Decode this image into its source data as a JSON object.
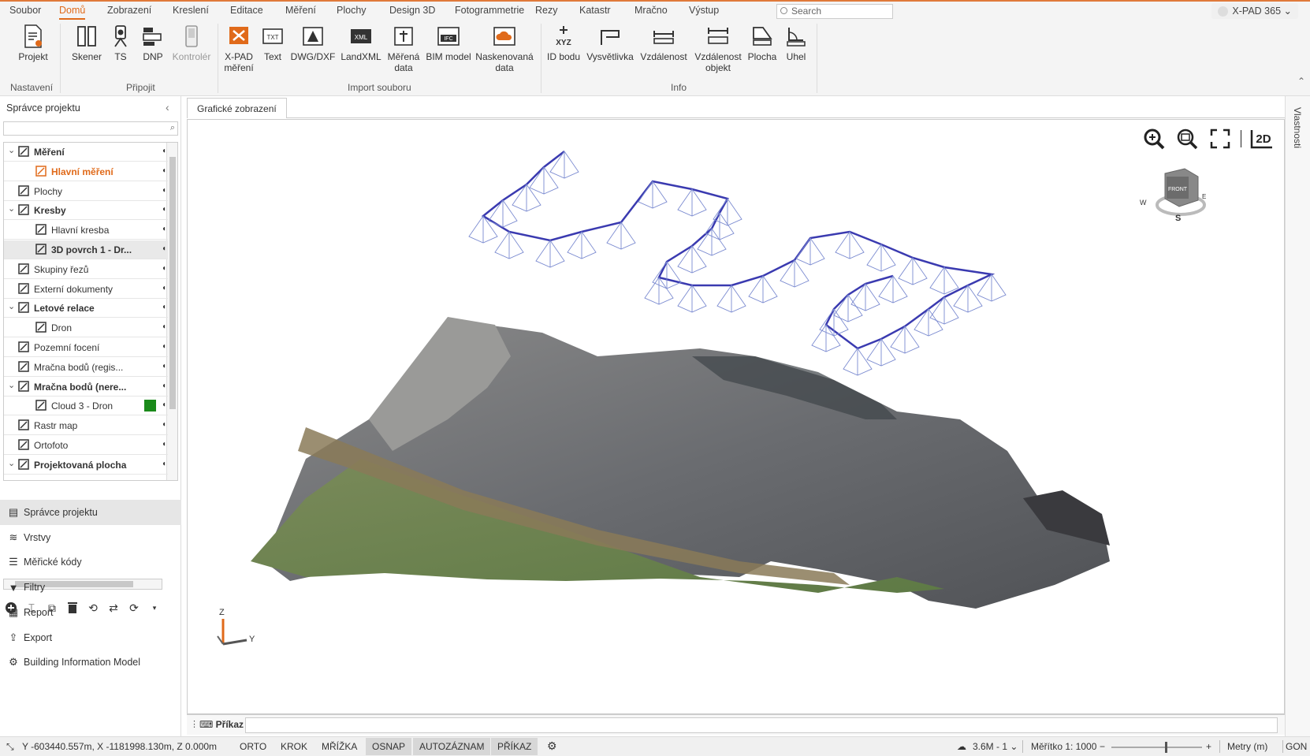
{
  "menu": {
    "items": [
      "Soubor",
      "Domů",
      "Zobrazení",
      "Kreslení",
      "Editace",
      "Měření",
      "Plochy",
      "Design 3D",
      "Fotogrammetrie",
      "Rezy",
      "Katastr",
      "Mračno",
      "Výstup"
    ],
    "search_placeholder": "Search",
    "product": "X-PAD 365"
  },
  "ribbon": {
    "buttons": {
      "projekt": "Projekt",
      "skener": "Skener",
      "ts": "TS",
      "dnp": "DNP",
      "kontroler": "Kontrolér",
      "xpad_mereni": "X-PAD měření",
      "text": "Text",
      "dwg": "DWG/DXF",
      "landxml": "LandXML",
      "merena_data": "Měřená data",
      "bim": "BIM model",
      "naskenovana": "Naskenovaná data",
      "id_bodu": "ID bodu",
      "vysvetlivka": "Vysvětlivka",
      "vzdalenost": "Vzdálenost",
      "vzdalenost_objekt": "Vzdálenost objekt",
      "plocha": "Plocha",
      "uhel": "Uhel"
    },
    "groups": {
      "nastaveni": "Nastavení",
      "pripojit": "Připojit",
      "import": "Import souboru",
      "info": "Info"
    }
  },
  "panel": {
    "title": "Správce projektu",
    "tree": [
      {
        "label": "Měření",
        "bold": true,
        "level": 0,
        "expanded": true
      },
      {
        "label": "Hlavní měření",
        "bold": true,
        "level": 1,
        "accent": true
      },
      {
        "label": "Plochy",
        "bold": false,
        "level": 0
      },
      {
        "label": "Kresby",
        "bold": true,
        "level": 0,
        "expanded": true
      },
      {
        "label": "Hlavní kresba",
        "bold": false,
        "level": 1
      },
      {
        "label": "3D povrch 1 - Dr...",
        "bold": true,
        "level": 1,
        "selected": true
      },
      {
        "label": "Skupiny řezů",
        "bold": false,
        "level": 0
      },
      {
        "label": "Externí dokumenty",
        "bold": false,
        "level": 0
      },
      {
        "label": "Letové relace",
        "bold": true,
        "level": 0,
        "expanded": true
      },
      {
        "label": "Dron",
        "bold": false,
        "level": 1
      },
      {
        "label": "Pozemní focení",
        "bold": false,
        "level": 0
      },
      {
        "label": "Mračna bodů (regis...",
        "bold": false,
        "level": 0
      },
      {
        "label": "Mračna bodů (nere...",
        "bold": true,
        "level": 0,
        "expanded": true
      },
      {
        "label": "Cloud 3 - Dron",
        "bold": false,
        "level": 1,
        "swatch": "#1a8a1a"
      },
      {
        "label": "Rastr map",
        "bold": false,
        "level": 0
      },
      {
        "label": "Ortofoto",
        "bold": false,
        "level": 0
      },
      {
        "label": "Projektovaná plocha",
        "bold": true,
        "level": 0,
        "expanded": true
      }
    ],
    "nav": [
      "Správce projektu",
      "Vrstvy",
      "Měřické kódy",
      "Filtry",
      "Report",
      "Export",
      "Building Information Model"
    ]
  },
  "tab": {
    "label": "Grafické zobrazení"
  },
  "viewport": {
    "view_mode": "2D",
    "cube_face": "FRONT",
    "cube_w": "W",
    "cube_e": "E",
    "cube_s": "S",
    "axes": {
      "z": "Z",
      "y": "Y"
    }
  },
  "command": {
    "label": "Příkaz"
  },
  "status": {
    "coords": "Y -603440.557m, X -1181998.130m, Z 0.000m",
    "toggles": [
      {
        "label": "ORTO",
        "on": false
      },
      {
        "label": "KROK",
        "on": false
      },
      {
        "label": "MŘÍŽKA",
        "on": false
      },
      {
        "label": "OSNAP",
        "on": true
      },
      {
        "label": "AUTOZÁZNAM",
        "on": true
      },
      {
        "label": "PŘÍKAZ",
        "on": true
      }
    ],
    "cloud": "3.6M - 1",
    "scale": "Měřítko 1: 1000",
    "units": "Metry (m)",
    "angle": "GON"
  },
  "side": {
    "label": "Vlastnosti"
  },
  "colors": {
    "accent": "#e06a1a",
    "flight_line": "#3a3ab0",
    "frustum": "#7a8ad0",
    "label": "#e07a2a"
  }
}
